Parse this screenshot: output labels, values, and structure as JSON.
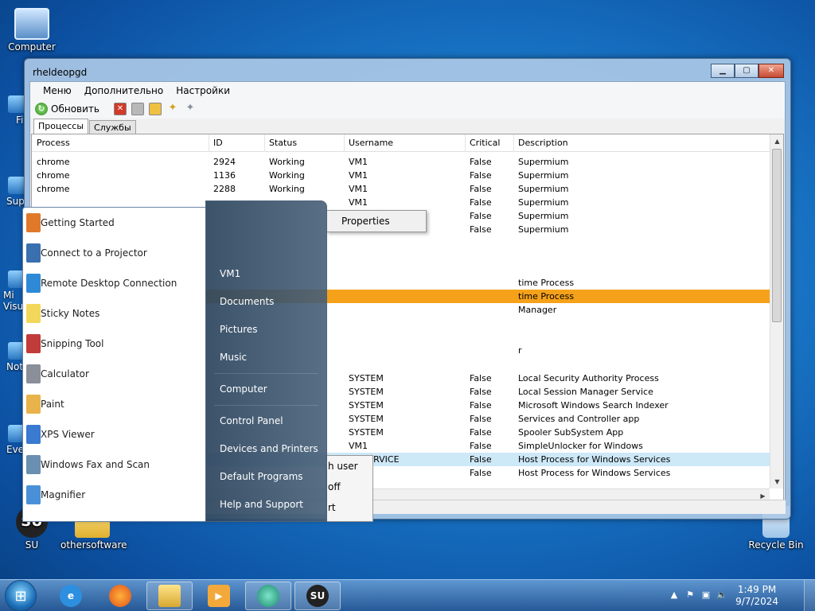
{
  "desktop": {
    "icons": [
      {
        "id": "computer",
        "label": "Computer"
      },
      {
        "id": "su",
        "label": "SU"
      },
      {
        "id": "othersoftware",
        "label": "othersoftware"
      },
      {
        "id": "recycle",
        "label": "Recycle Bin"
      }
    ],
    "edge_labels": [
      "Fi",
      "Sup",
      "Mi\nVisu",
      "Not",
      "Eve"
    ]
  },
  "window": {
    "title": "rheldeopgd",
    "buttons": {
      "minimize": "▁",
      "maximize": "▢",
      "close": "✕"
    },
    "menu": [
      "Меню",
      "Дополнительно",
      "Настройки"
    ],
    "toolbar": {
      "refresh_label": "Обновить"
    },
    "tabs": [
      "Процессы",
      "Службы"
    ],
    "columns": [
      "Process",
      "ID",
      "Status",
      "Username",
      "Critical",
      "Description"
    ],
    "rows_top": [
      {
        "process": "chrome",
        "id": "2924",
        "status": "Working",
        "user": "VM1",
        "critical": "False",
        "desc": "Supermium"
      },
      {
        "process": "chrome",
        "id": "1136",
        "status": "Working",
        "user": "VM1",
        "critical": "False",
        "desc": "Supermium"
      },
      {
        "process": "chrome",
        "id": "2288",
        "status": "Working",
        "user": "VM1",
        "critical": "False",
        "desc": "Supermium"
      },
      {
        "process": "",
        "id": "",
        "status": "",
        "user": "VM1",
        "critical": "False",
        "desc": "Supermium"
      },
      {
        "process": "",
        "id": "",
        "status": "",
        "user": "VM1",
        "critical": "False",
        "desc": "Supermium"
      },
      {
        "process": "",
        "id": "",
        "status": "",
        "user": "VM1",
        "critical": "False",
        "desc": "Supermium"
      }
    ],
    "rows_partial": [
      {
        "desc": "time Process"
      },
      {
        "desc": "time Process"
      },
      {
        "desc": " Manager"
      },
      {
        "desc": "r"
      }
    ],
    "rows_bottom": [
      {
        "user": "SYSTEM",
        "critical": "False",
        "desc": "Local Security Authority Process"
      },
      {
        "user": "SYSTEM",
        "critical": "False",
        "desc": "Local Session Manager Service"
      },
      {
        "user": "SYSTEM",
        "critical": "False",
        "desc": "Microsoft Windows Search Indexer"
      },
      {
        "user": "SYSTEM",
        "critical": "False",
        "desc": "Services and Controller app"
      },
      {
        "user": "SYSTEM",
        "critical": "False",
        "desc": "Spooler SubSystem App"
      },
      {
        "user": "VM1",
        "critical": "False",
        "desc": "SimpleUnlocker for Windows"
      },
      {
        "user": "AL SERVICE",
        "critical": "False",
        "desc": "Host Process for Windows Services"
      },
      {
        "user": "STEM",
        "critical": "False",
        "desc": "Host Process for Windows Services"
      }
    ]
  },
  "context_menu": {
    "items": [
      "Properties"
    ]
  },
  "context_menu_partial": {
    "items": [
      "h user",
      "off",
      "rt"
    ]
  },
  "start_menu": {
    "programs": [
      "Getting Started",
      "Connect to a Projector",
      "Remote Desktop Connection",
      "Sticky Notes",
      "Snipping Tool",
      "Calculator",
      "Paint",
      "XPS Viewer",
      "Windows Fax and Scan",
      "Magnifier"
    ],
    "right": [
      "VM1",
      "Documents",
      "Pictures",
      "Music",
      "Computer",
      "Control Panel",
      "Devices and Printers",
      "Default Programs",
      "Help and Support"
    ]
  },
  "taskbar": {
    "time": "1:49 PM",
    "date": "9/7/2024",
    "su_label": "SU"
  }
}
